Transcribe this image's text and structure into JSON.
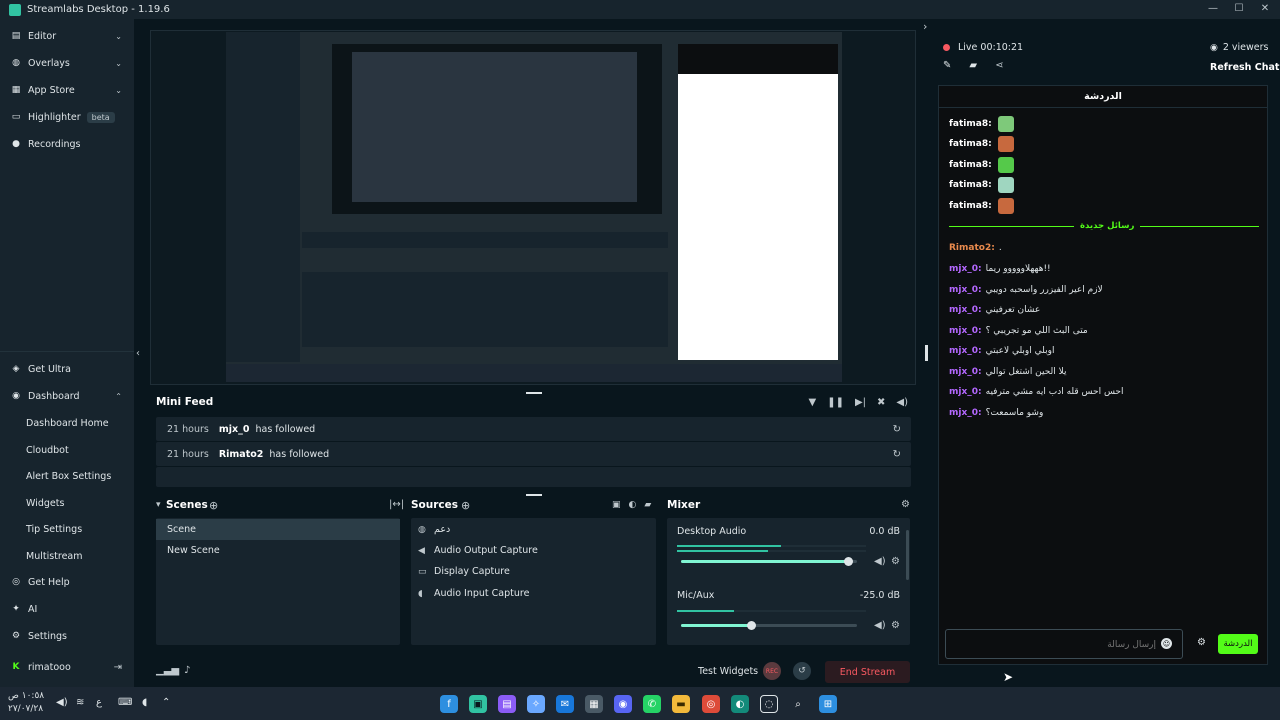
{
  "app": {
    "title": "Streamlabs Desktop - 1.19.6"
  },
  "sidebar": {
    "top_items": [
      {
        "label": "Editor",
        "icon": "editor-icon"
      },
      {
        "label": "Overlays",
        "icon": "overlays-icon"
      },
      {
        "label": "App Store",
        "icon": "app-store-icon"
      },
      {
        "label": "Highlighter",
        "icon": "highlighter-icon",
        "badge": "beta"
      },
      {
        "label": "Recordings",
        "icon": "recordings-icon"
      }
    ],
    "bottom_items": [
      {
        "label": "Get Ultra",
        "icon": "ultra-icon"
      },
      {
        "label": "Dashboard",
        "icon": "dashboard-icon"
      },
      {
        "label": "Dashboard Home",
        "sub": true
      },
      {
        "label": "Cloudbot",
        "sub": true
      },
      {
        "label": "Alert Box Settings",
        "sub": true
      },
      {
        "label": "Widgets",
        "sub": true
      },
      {
        "label": "Tip Settings",
        "sub": true
      },
      {
        "label": "Multistream",
        "sub": true
      },
      {
        "label": "Get Help",
        "icon": "help-icon"
      },
      {
        "label": "AI",
        "icon": "ai-icon"
      },
      {
        "label": "Settings",
        "icon": "settings-icon"
      },
      {
        "label": "rimatooo",
        "icon": "kick-icon"
      }
    ]
  },
  "minifeed": {
    "title": "Mini Feed",
    "rows": [
      {
        "time": "21 hours",
        "user": "mjx_0",
        "action": "has followed"
      },
      {
        "time": "21 hours",
        "user": "Rimato2",
        "action": "has followed"
      }
    ]
  },
  "scenes": {
    "title": "Scenes",
    "items": [
      {
        "label": "Scene",
        "selected": true
      },
      {
        "label": "New Scene",
        "selected": false
      }
    ]
  },
  "sources": {
    "title": "Sources",
    "items": [
      {
        "label": "دعم",
        "icon": "globe-icon"
      },
      {
        "label": "Audio Output Capture",
        "icon": "speaker-icon"
      },
      {
        "label": "Display Capture",
        "icon": "monitor-icon"
      },
      {
        "label": "Audio Input Capture",
        "icon": "mic-icon"
      }
    ]
  },
  "mixer": {
    "title": "Mixer",
    "channels": [
      {
        "name": "Desktop Audio",
        "db": "0.0 dB",
        "level": 0.95,
        "meter": 0.55
      },
      {
        "name": "Mic/Aux",
        "db": "-25.0 dB",
        "level": 0.4,
        "meter": 0.3
      }
    ]
  },
  "footer": {
    "test_widgets": "Test Widgets",
    "end_stream": "End Stream"
  },
  "chat": {
    "live_label": "Live 00:10:21",
    "viewers": "2 viewers",
    "refresh": "Refresh Chat",
    "tab_title": "الدردشة",
    "divider": "رسائل جديدة",
    "placeholder": "إرسال رسالة",
    "send_label": "الدردشة",
    "emote_lines": [
      {
        "user": "fatima8:",
        "emote": "#7ec97a"
      },
      {
        "user": "fatima8:",
        "emote": "#c7693e"
      },
      {
        "user": "fatima8:",
        "emote": "#55c94a"
      },
      {
        "user": "fatima8:",
        "emote": "#9fd6c0"
      },
      {
        "user": "fatima8:",
        "emote": "#c7693e"
      }
    ],
    "messages": [
      {
        "user": "Rimato2:",
        "text": ".",
        "color": "#e98a4d"
      },
      {
        "user": "mjx_0:",
        "text": "هههلاووووو ريما!!",
        "color": "#b468ff"
      },
      {
        "user": "mjx_0:",
        "text": "لازم اعير الفيزرر واسحبه دويبي",
        "color": "#b468ff"
      },
      {
        "user": "mjx_0:",
        "text": "عشان تعرفيني",
        "color": "#b468ff"
      },
      {
        "user": "mjx_0:",
        "text": "متى البث اللي مو تجريبي ؟",
        "color": "#b468ff"
      },
      {
        "user": "mjx_0:",
        "text": "اوبلي اوبلي لاعبتي",
        "color": "#b468ff"
      },
      {
        "user": "mjx_0:",
        "text": "يلا الحين اشتغل توالي",
        "color": "#b468ff"
      },
      {
        "user": "mjx_0:",
        "text": "احس احس قله ادب ايه مشي مترفيه",
        "color": "#b468ff"
      },
      {
        "user": "mjx_0:",
        "text": "وشو ماسمعت؟",
        "color": "#b468ff"
      }
    ]
  },
  "taskbar": {
    "time": "١٠:٥٨ ص",
    "date": "٢٧/٠٧/٢٨",
    "lang": "ع"
  },
  "colors": {
    "accent": "#31c3a2",
    "live": "#f85961",
    "kick": "#53fc18"
  }
}
